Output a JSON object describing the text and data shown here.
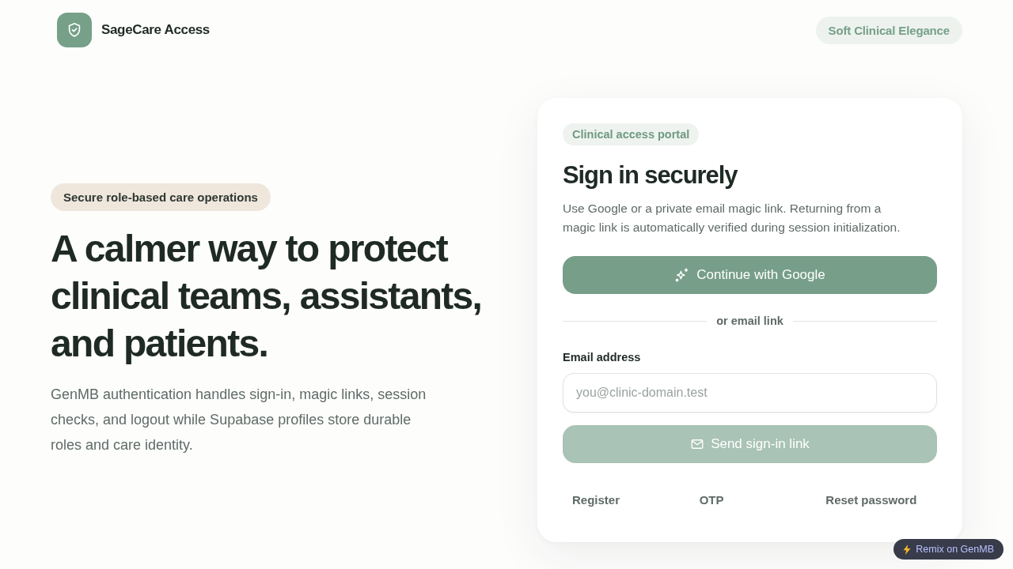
{
  "header": {
    "brand": "SageCare Access",
    "theme_badge": "Soft Clinical Elegance"
  },
  "hero": {
    "tag": "Secure role-based care operations",
    "headline": "A calmer way to protect clinical teams, assistants, and patients.",
    "description": "GenMB authentication handles sign-in, magic links, session checks, and logout while Supabase profiles store durable roles and care identity."
  },
  "sign_in_card": {
    "tag": "Clinical access portal",
    "title": "Sign in securely",
    "description": "Use Google or a private email magic link. Returning from a magic link is automatically verified during session initialization.",
    "google_button": {
      "label": "Continue with Google"
    },
    "divider": "or email link",
    "email_field": {
      "label": "Email address",
      "placeholder": "you@clinic-domain.test"
    },
    "send_button": {
      "label": "Send sign-in link",
      "disabled": true
    },
    "links": [
      "Register",
      "OTP",
      "Reset password"
    ]
  },
  "remix_badge": {
    "label": "Remix on GenMB"
  }
}
